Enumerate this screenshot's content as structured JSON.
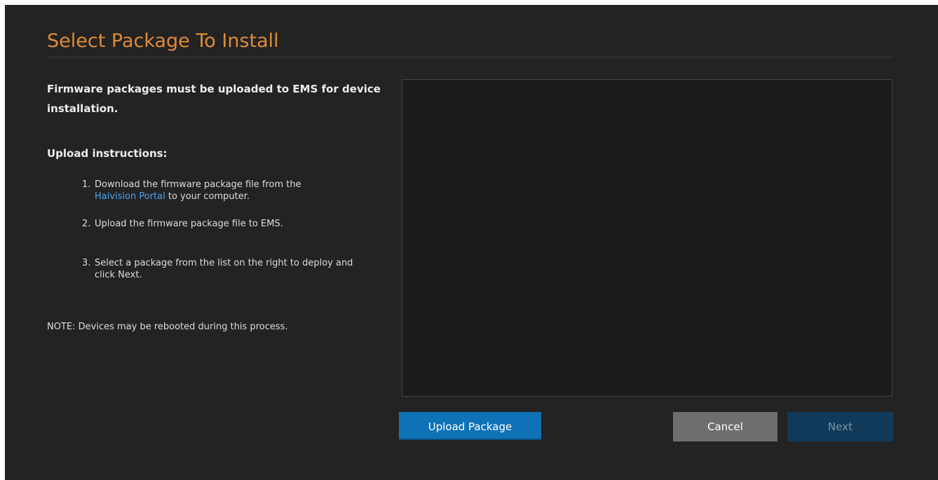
{
  "dialog": {
    "title": "Select Package To Install"
  },
  "instructions": {
    "intro": "Firmware packages must be uploaded to EMS for device installation.",
    "subhead": "Upload instructions:",
    "step1": {
      "num": "1.",
      "before_link": "Download the firmware package file from the",
      "link_text": "Haivision Portal",
      "after_link": " to your computer."
    },
    "step2": {
      "num": "2.",
      "text": "Upload the firmware package file to EMS."
    },
    "step3": {
      "num": "3.",
      "text": "Select a package from the list on the right to deploy and click Next."
    },
    "note": "NOTE: Devices may be rebooted during this process."
  },
  "buttons": {
    "upload_label": "Upload Package",
    "cancel_label": "Cancel",
    "next_label": "Next"
  },
  "colors": {
    "title": "#e08a36",
    "background": "#232323",
    "list_background": "#1c1c1c",
    "link": "#4aa3ef",
    "primary_button": "#0f72b7",
    "cancel_button": "#6e6e6e",
    "next_button_disabled": "#113a5a"
  }
}
